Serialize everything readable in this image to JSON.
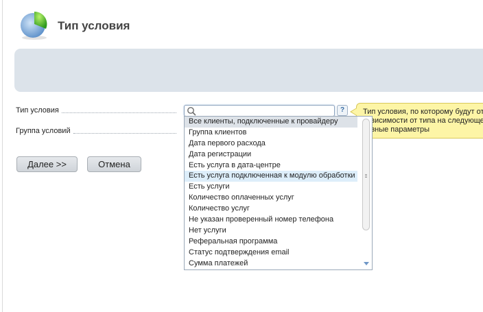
{
  "page": {
    "title": "Тип условия"
  },
  "form": {
    "condition_type_label": "Тип условия",
    "condition_group_label": "Группа условий",
    "search": {
      "value": "",
      "placeholder": ""
    },
    "help_label": "?",
    "tooltip_lines": [
      "Тип условия, по которому будут от",
      "зависимости от типа на следующе",
      "разные параметры"
    ],
    "options": [
      {
        "label": "Все клиенты, подключенные к провайдеру",
        "state": "selected"
      },
      {
        "label": "Группа клиентов",
        "state": ""
      },
      {
        "label": "Дата первого расхода",
        "state": ""
      },
      {
        "label": "Дата регистрации",
        "state": ""
      },
      {
        "label": "Есть услуга в дата-центре",
        "state": ""
      },
      {
        "label": "Есть услуга подключенная к модулю обработки",
        "state": "hover"
      },
      {
        "label": "Есть услуги",
        "state": ""
      },
      {
        "label": "Количество оплаченных услуг",
        "state": ""
      },
      {
        "label": "Количество услуг",
        "state": ""
      },
      {
        "label": "Не указан проверенный номер телефона",
        "state": ""
      },
      {
        "label": "Нет услуги",
        "state": ""
      },
      {
        "label": "Реферальная программа",
        "state": ""
      },
      {
        "label": "Статус подтверждения email",
        "state": ""
      },
      {
        "label": "Сумма платежей",
        "state": ""
      }
    ]
  },
  "buttons": {
    "next_label": "Далее >>",
    "cancel_label": "Отмена"
  },
  "colors": {
    "banner": "#dce3ea",
    "tooltip": "#fdf5a6",
    "hover_row": "#ddeefa",
    "selected_row": "#dde2e8"
  }
}
